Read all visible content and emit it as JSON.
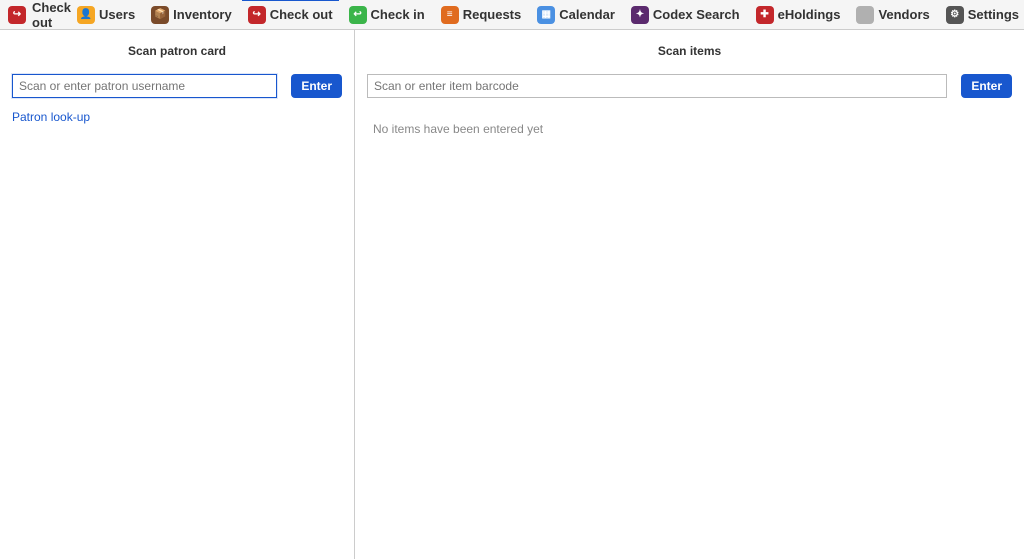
{
  "app_title": "Check out",
  "nav": {
    "items": [
      {
        "label": "Users",
        "icon_bg": "#f5a623",
        "glyph": "👤"
      },
      {
        "label": "Inventory",
        "icon_bg": "#7b4b2a",
        "glyph": "📦"
      },
      {
        "label": "Check out",
        "icon_bg": "#c3272b",
        "glyph": "↪",
        "active": true
      },
      {
        "label": "Check in",
        "icon_bg": "#3bb54a",
        "glyph": "↩"
      },
      {
        "label": "Requests",
        "icon_bg": "#e06b1f",
        "glyph": "≡"
      },
      {
        "label": "Calendar",
        "icon_bg": "#4a90e2",
        "glyph": "▦"
      },
      {
        "label": "Codex Search",
        "icon_bg": "#5b2a6e",
        "glyph": "✦"
      },
      {
        "label": "eHoldings",
        "icon_bg": "#c3272b",
        "glyph": "✚"
      },
      {
        "label": "Vendors",
        "icon_bg": "#b0b0b0",
        "glyph": " "
      },
      {
        "label": "Settings",
        "icon_bg": "#555555",
        "glyph": "⚙"
      }
    ]
  },
  "left": {
    "title": "Scan patron card",
    "placeholder": "Scan or enter patron username",
    "enter": "Enter",
    "lookup_link": "Patron look-up"
  },
  "right": {
    "title": "Scan items",
    "placeholder": "Scan or enter item barcode",
    "enter": "Enter",
    "empty_message": "No items have been entered yet"
  },
  "title_icon_bg": "#c3272b",
  "title_glyph": "↪"
}
